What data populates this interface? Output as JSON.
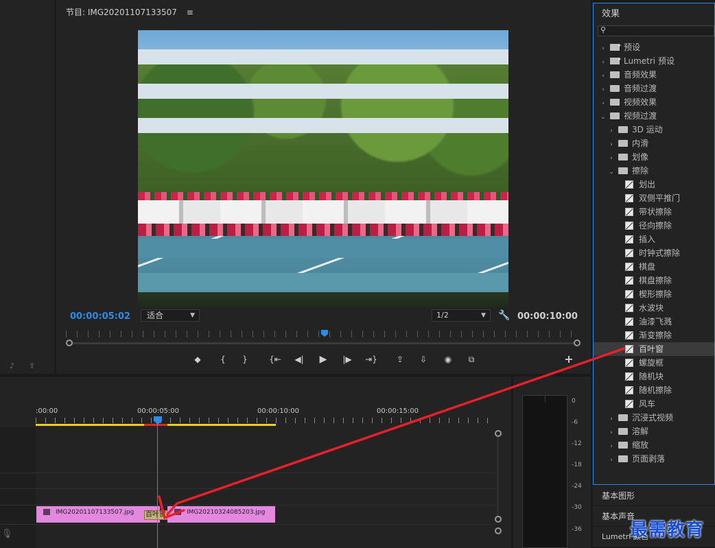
{
  "program": {
    "title": "节目: IMG20201107133507",
    "menu_glyph": "≡",
    "timecode_current": "00:00:05:02",
    "fit_value": "适合",
    "resolution_value": "1/2",
    "timecode_duration": "00:00:10:00",
    "controls": {
      "add_marker": "◆",
      "mark_in": "{",
      "mark_out": "}",
      "go_to_in": "{⇤",
      "step_back": "◀|",
      "play": "▶",
      "step_forward": "|▶",
      "go_to_out": "⇥}",
      "lift": "⇪",
      "extract": "⇩",
      "export_frame": "◉",
      "compare": "⧉",
      "add_button": "+"
    }
  },
  "timeline": {
    "ruler_labels": [
      ":00:00",
      "00:00:05:00",
      "00:00:10:00",
      "00:00:15:00"
    ],
    "clips": [
      {
        "name": "IMG20201107133507.jpg"
      },
      {
        "name": "IMG20210324085203.jpg"
      }
    ],
    "transition_label": "百叶窗"
  },
  "audio_meter": {
    "scale": [
      "0",
      "-6",
      "-12",
      "-18",
      "-24",
      "-30",
      "-36"
    ]
  },
  "effects": {
    "title": "效果",
    "search_placeholder": "",
    "tree": [
      {
        "label": "预设",
        "level": 0,
        "icon": "preset-bin",
        "expanded": false
      },
      {
        "label": "Lumetri 预设",
        "level": 0,
        "icon": "preset-bin",
        "expanded": false
      },
      {
        "label": "音频效果",
        "level": 0,
        "icon": "bin",
        "expanded": false
      },
      {
        "label": "音频过渡",
        "level": 0,
        "icon": "bin",
        "expanded": false
      },
      {
        "label": "视频效果",
        "level": 0,
        "icon": "bin",
        "expanded": false
      },
      {
        "label": "视频过渡",
        "level": 0,
        "icon": "bin",
        "expanded": true
      },
      {
        "label": "3D 运动",
        "level": 1,
        "icon": "folder",
        "expanded": false
      },
      {
        "label": "内滑",
        "level": 1,
        "icon": "folder",
        "expanded": false
      },
      {
        "label": "划像",
        "level": 1,
        "icon": "folder",
        "expanded": false
      },
      {
        "label": "擦除",
        "level": 1,
        "icon": "folder",
        "expanded": true
      },
      {
        "label": "划出",
        "level": 2,
        "icon": "transition"
      },
      {
        "label": "双侧平推门",
        "level": 2,
        "icon": "transition"
      },
      {
        "label": "带状擦除",
        "level": 2,
        "icon": "transition"
      },
      {
        "label": "径向擦除",
        "level": 2,
        "icon": "transition"
      },
      {
        "label": "插入",
        "level": 2,
        "icon": "transition"
      },
      {
        "label": "时钟式擦除",
        "level": 2,
        "icon": "transition"
      },
      {
        "label": "棋盘",
        "level": 2,
        "icon": "transition"
      },
      {
        "label": "棋盘擦除",
        "level": 2,
        "icon": "transition"
      },
      {
        "label": "楔形擦除",
        "level": 2,
        "icon": "transition"
      },
      {
        "label": "水波块",
        "level": 2,
        "icon": "transition"
      },
      {
        "label": "油漆飞溅",
        "level": 2,
        "icon": "transition"
      },
      {
        "label": "渐变擦除",
        "level": 2,
        "icon": "transition"
      },
      {
        "label": "百叶窗",
        "level": 2,
        "icon": "transition",
        "selected": true
      },
      {
        "label": "螺旋框",
        "level": 2,
        "icon": "transition"
      },
      {
        "label": "随机块",
        "level": 2,
        "icon": "transition"
      },
      {
        "label": "随机擦除",
        "level": 2,
        "icon": "transition"
      },
      {
        "label": "风车",
        "level": 2,
        "icon": "transition"
      },
      {
        "label": "沉浸式视频",
        "level": 1,
        "icon": "folder",
        "expanded": false
      },
      {
        "label": "溶解",
        "level": 1,
        "icon": "folder",
        "expanded": false
      },
      {
        "label": "缩放",
        "level": 1,
        "icon": "folder",
        "expanded": false
      },
      {
        "label": "页面剥落",
        "level": 1,
        "icon": "folder",
        "expanded": false
      }
    ]
  },
  "side_tabs": [
    "基本图形",
    "基本声音",
    "Lumetri 颜色"
  ],
  "watermark": "最需教育",
  "colors": {
    "accent_blue": "#2d8ceb",
    "clip_pink": "#e488df",
    "work_area_yellow": "#e8d21d",
    "annotation_red": "#e8202a",
    "watermark_blue": "#1a4fd4"
  }
}
